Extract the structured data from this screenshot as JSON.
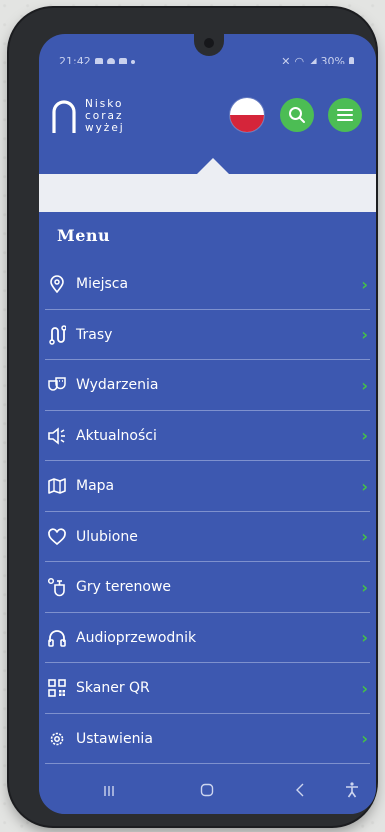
{
  "status": {
    "time": "21:42",
    "battery": "30%"
  },
  "brand": {
    "line1": "Nisko",
    "line2": "coraz",
    "line3": "wyżej"
  },
  "menu": {
    "title": "Menu",
    "items": [
      {
        "label": "Miejsca",
        "icon": "location-pin-icon"
      },
      {
        "label": "Trasy",
        "icon": "route-icon"
      },
      {
        "label": "Wydarzenia",
        "icon": "theater-masks-icon"
      },
      {
        "label": "Aktualności",
        "icon": "megaphone-icon"
      },
      {
        "label": "Mapa",
        "icon": "map-icon"
      },
      {
        "label": "Ulubione",
        "icon": "heart-icon"
      },
      {
        "label": "Gry terenowe",
        "icon": "field-game-icon"
      },
      {
        "label": "Audioprzewodnik",
        "icon": "headphones-icon"
      },
      {
        "label": "Skaner QR",
        "icon": "qr-code-icon"
      },
      {
        "label": "Ustawienia",
        "icon": "gear-icon"
      }
    ]
  },
  "colors": {
    "primary": "#3d58b0",
    "accent": "#4cbd54",
    "chevron": "#44c148",
    "flag_red": "#d5253a"
  }
}
